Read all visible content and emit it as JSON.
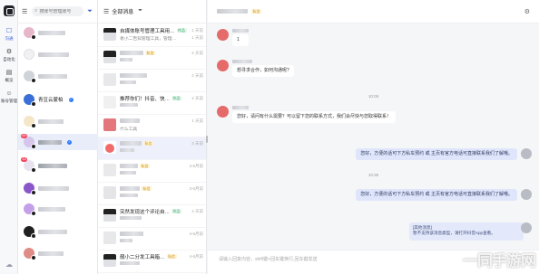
{
  "rail": {
    "items": [
      {
        "label": "沟通",
        "icon": "chat-icon"
      },
      {
        "label": "自动化",
        "icon": "automation-icon"
      },
      {
        "label": "概览",
        "icon": "overview-icon"
      },
      {
        "label": "账号管理",
        "icon": "account-icon"
      }
    ]
  },
  "accounts": {
    "search_placeholder": "搜账号管理账号",
    "named_account": "青豆云蒙柏",
    "badges": [
      "69",
      "14"
    ]
  },
  "conversations": {
    "header": "全部消息",
    "items": [
      {
        "title": "自媒体账号管理工具用…",
        "tag": "作品",
        "preview": "易小二告知管理工具，管理…",
        "time1": "1 天前",
        "time2": "1 天前"
      },
      {
        "title": "",
        "tag": "私信",
        "preview": "",
        "time1": "2 天前",
        "time2": ""
      },
      {
        "title": "",
        "tag": "",
        "preview": "",
        "time1": "2 天前",
        "time2": ""
      },
      {
        "title": "推荐你们！抖音、快…",
        "tag": "作品",
        "preview": "",
        "time1": "2 天前",
        "time2": ""
      },
      {
        "title": "",
        "tag": "",
        "preview": "什么工具",
        "time1": "1 天前",
        "time2": ""
      },
      {
        "title": "",
        "tag": "私信",
        "preview": "",
        "time1": "3 天前",
        "time2": ""
      },
      {
        "title": "",
        "tag": "私信",
        "preview": "",
        "time1": "3-6月前",
        "time2": ""
      },
      {
        "title": "",
        "tag": "私信",
        "preview": "",
        "time1": "3-6月前",
        "time2": ""
      },
      {
        "title": "突然发现这个评论自…",
        "tag": "作品",
        "preview": "",
        "time1": "4 天前",
        "time2": ""
      },
      {
        "title": "",
        "tag": "",
        "preview": "",
        "time1": "4-6月前",
        "time2": ""
      },
      {
        "title": "",
        "tag": "私信",
        "preview": "",
        "time1": "4-6月前",
        "time2": ""
      },
      {
        "title": "靓小二分发工具箱…",
        "tag": "私信",
        "preview": "",
        "time1": "4-6月前",
        "time2": ""
      }
    ]
  },
  "chat": {
    "header_tag": "私信",
    "messages": {
      "m1": "1",
      "m2": "想寻求合作，如何沟通呢?",
      "ts1": "10:09",
      "m3": "您好，请问有什么需要？可以留下您的联系方式，我们会尽快与您取得联系！",
      "r1": "您好，方便的话可下方私车预约 或 主页有官方电话可直接联系我们了解哦。",
      "ts2": "10:36",
      "r2": "您好，方便的话可下方私车预约 或 主页有官方电话可直接联系我们了解哦。",
      "notice_title": "[其他消息]",
      "notice_body": "暂不支持该消息类型，请打开抖音App查看。"
    },
    "composer_placeholder": "请输入回复内容，shift键+回车键换行,回车键发送"
  },
  "watermark": "一同手游网"
}
